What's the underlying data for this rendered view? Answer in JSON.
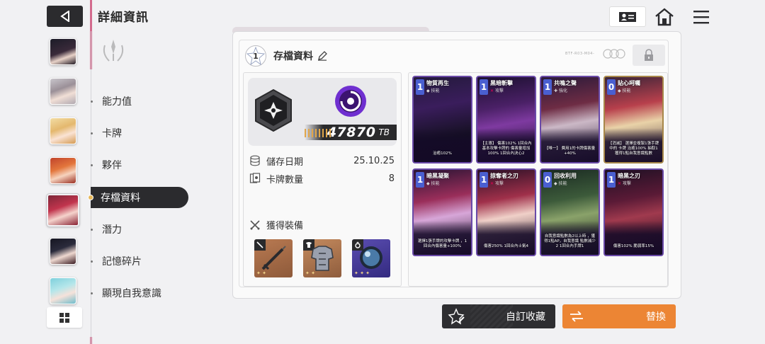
{
  "header": {
    "title": "詳細資訊"
  },
  "menu": {
    "items": [
      {
        "label": "能力值"
      },
      {
        "label": "卡牌"
      },
      {
        "label": "夥伴"
      },
      {
        "label": "存檔資料"
      },
      {
        "label": "潛力"
      },
      {
        "label": "記憶碎片"
      },
      {
        "label": "顯現自我意識"
      }
    ],
    "active_index": 3
  },
  "save": {
    "number": "1",
    "title": "存檔資料",
    "tiny_label": "BTF-R03-M04-",
    "capacity_value": "47870",
    "capacity_unit": "TB",
    "date_label": "儲存日期",
    "date_value": "25.10.25",
    "card_count_label": "卡牌數量",
    "card_count_value": "8",
    "equipment_label": "獲得裝備"
  },
  "equipment": [
    {
      "icon": "sword-icon"
    },
    {
      "icon": "armor-icon"
    },
    {
      "icon": "ring-icon"
    }
  ],
  "cards": [
    {
      "cost": "1",
      "name": "物質再生",
      "type": "技能",
      "desc": "治癒102%"
    },
    {
      "cost": "1",
      "name": "黑暗斬擊",
      "type": "攻擊",
      "desc": "【主導】 傷害102% 1回合內基本攻擊卡牌的 傷害量增加100% 1回合內決心2"
    },
    {
      "cost": "1",
      "name": "共鳴之聲",
      "type": "強化",
      "desc": "【唯一】 費用1的卡牌傷害量 +40%"
    },
    {
      "cost": "0",
      "name": "貼心呵囑",
      "type": "技能",
      "desc": "【消滅】 選擇並複製1張手牌中的 卡牌 治癒100% 抽取1 獲得1點自我意識點數"
    },
    {
      "cost": "1",
      "name": "暗黑凝聚",
      "type": "技能",
      "desc": "選擇1張手牌的攻擊卡牌 ，1回合內傷害量+100%"
    },
    {
      "cost": "1",
      "name": "掠奪者之刃",
      "type": "攻擊",
      "desc": "傷害250% 1回合內士氣4"
    },
    {
      "cost": "0",
      "name": "回收利用",
      "type": "技能",
      "desc": "自我意識點數為2以上時 ，獲得1點AP，自我意識 點數減少2 1回合內手牌1"
    },
    {
      "cost": "1",
      "name": "暗黑之刃",
      "type": "攻擊",
      "desc": "傷害102% 脆弱率15%"
    }
  ],
  "buttons": {
    "favorite_label": "自訂收藏",
    "swap_label": "替換"
  },
  "colors": {
    "accent": "#ec8534",
    "dark": "#2b2b2e",
    "rail_pink": "#d36b8d",
    "card_purple": "#6a4aa8"
  }
}
